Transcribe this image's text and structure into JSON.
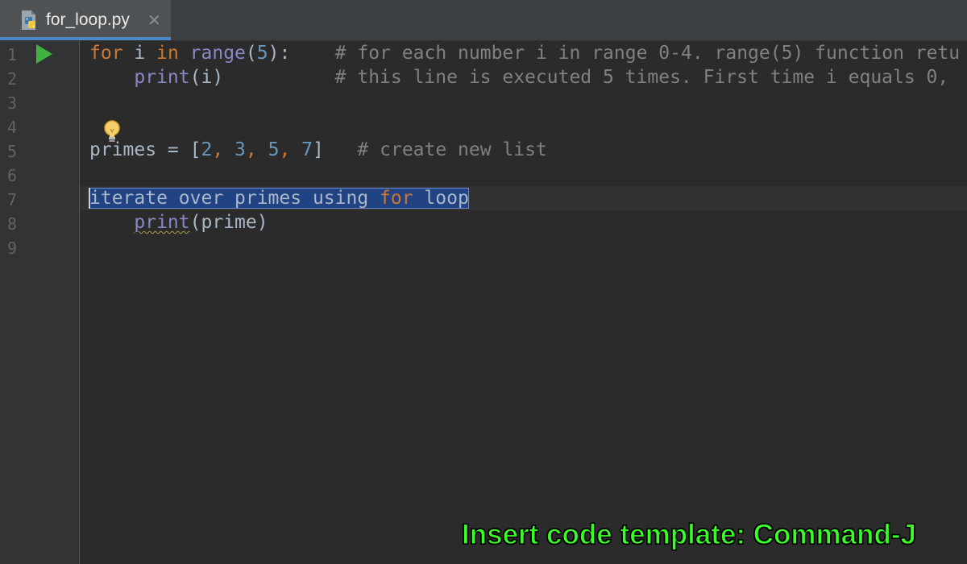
{
  "tab": {
    "filename": "for_loop.py",
    "close_glyph": "✕",
    "icon": "python-file-icon"
  },
  "gutter": {
    "line_numbers": [
      "1",
      "2",
      "3",
      "4",
      "5",
      "6",
      "7",
      "8",
      "9"
    ]
  },
  "code": {
    "line1": {
      "kw_for": "for",
      "var": " i ",
      "kw_in": "in",
      "sp": " ",
      "fn": "range",
      "open": "(",
      "num": "5",
      "close": "):",
      "comment": "    # for each number i in range 0-4. range(5) function retu"
    },
    "line2": {
      "indent": "    ",
      "fn": "print",
      "args": "(i)",
      "comment": "          # this line is executed 5 times. First time i equals 0,"
    },
    "line5": {
      "name": "primes = [",
      "n1": "2",
      "c1": ", ",
      "n2": "3",
      "c2": ", ",
      "n3": "5",
      "c3": ", ",
      "n4": "7",
      "end": "]",
      "comment": "   # create new list"
    },
    "line7": {
      "text_before": "iterate over primes using ",
      "kw_for": "for",
      "text_after": " loop"
    },
    "line8": {
      "indent": "    ",
      "fn": "print",
      "args": "(prime)"
    }
  },
  "colors": {
    "editor_bg": "#2b2b2b",
    "keyword": "#cc7832",
    "builtin": "#8888c6",
    "number": "#6897bb",
    "comment": "#808080",
    "selection": "#214283",
    "caption": "#3aff25",
    "tab_underline": "#4a88c7"
  },
  "caption": "Insert code template: Command-J"
}
